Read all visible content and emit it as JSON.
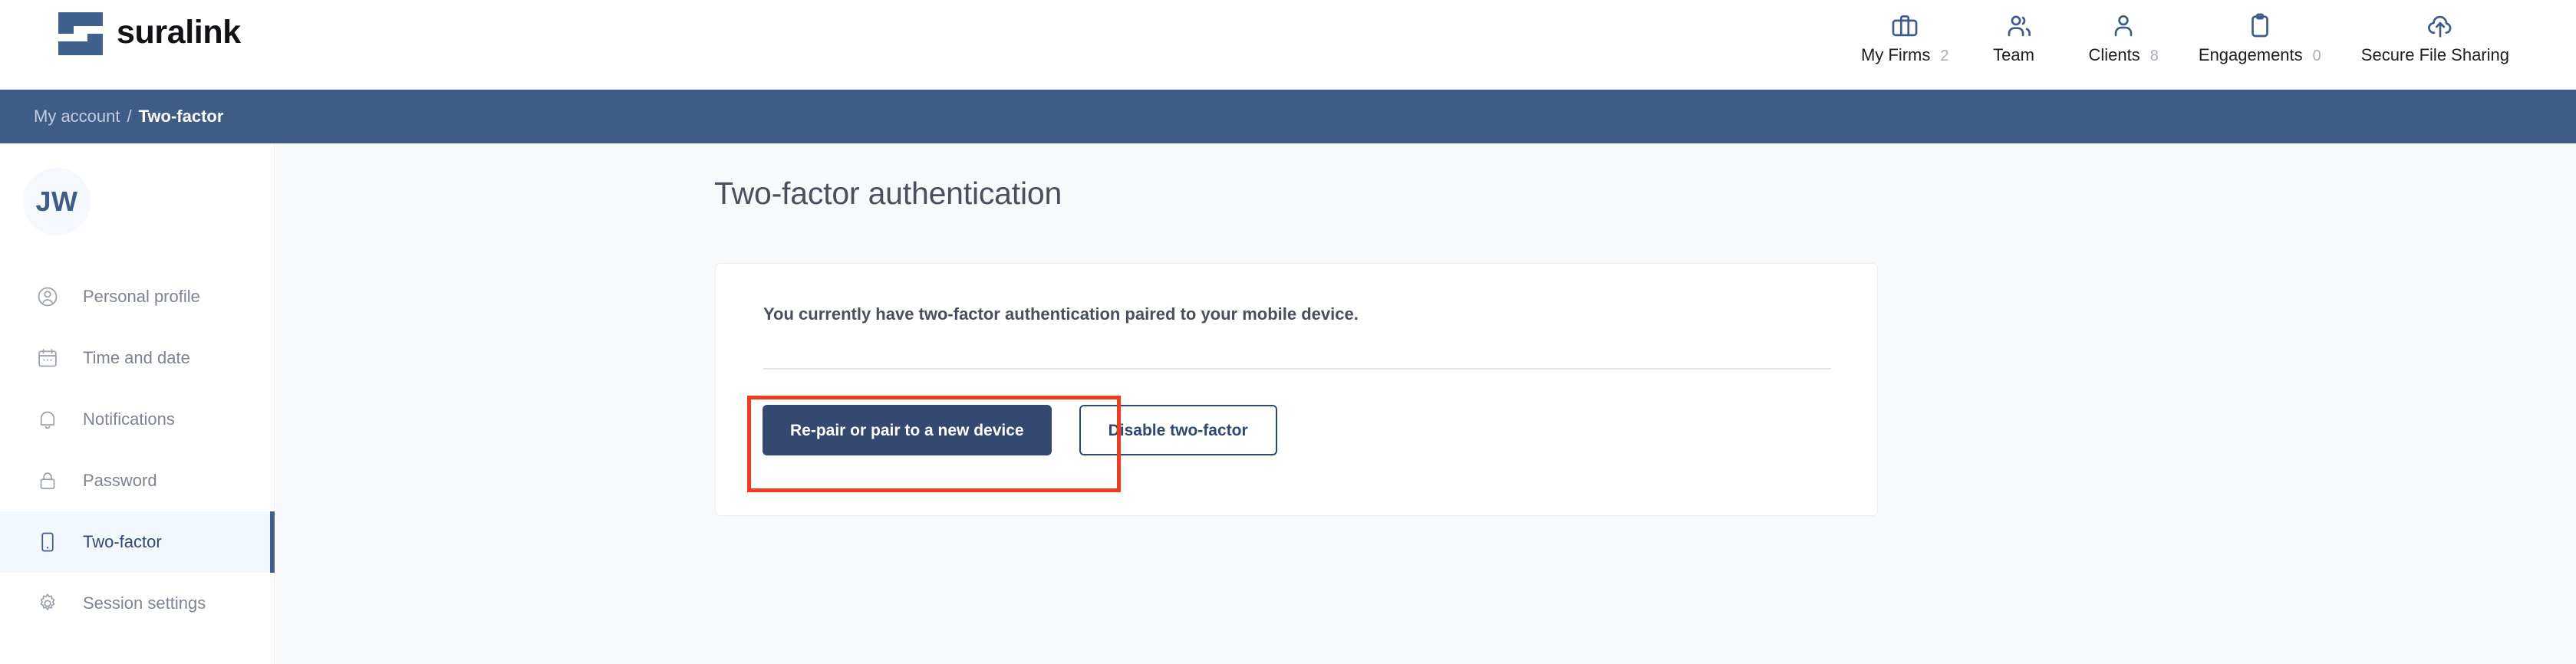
{
  "brand": {
    "name": "suralink",
    "logo_icon": "suralink-logo-icon",
    "accent_color": "#40618e"
  },
  "header": {
    "nav": [
      {
        "label": "My Firms",
        "count": "2",
        "icon": "briefcase-icon"
      },
      {
        "label": "Team",
        "count": "",
        "icon": "people-group-icon"
      },
      {
        "label": "Clients",
        "count": "8",
        "icon": "person-icon"
      },
      {
        "label": "Engagements",
        "count": "0",
        "icon": "clipboard-icon"
      },
      {
        "label": "Secure File Sharing",
        "count": "",
        "icon": "cloud-upload-icon"
      }
    ]
  },
  "breadcrumb": {
    "parent": "My account",
    "separator": "/",
    "current": "Two-factor",
    "bar_color": "#3f5c86"
  },
  "sidebar": {
    "avatar_initials": "JW",
    "items": [
      {
        "label": "Personal profile",
        "icon": "user-circle-icon",
        "active": false
      },
      {
        "label": "Time and date",
        "icon": "calendar-icon",
        "active": false
      },
      {
        "label": "Notifications",
        "icon": "bell-icon",
        "active": false
      },
      {
        "label": "Password",
        "icon": "lock-icon",
        "active": false
      },
      {
        "label": "Two-factor",
        "icon": "mobile-device-icon",
        "active": true
      },
      {
        "label": "Session settings",
        "icon": "gear-icon",
        "active": false
      }
    ]
  },
  "main": {
    "page_title": "Two-factor authentication",
    "card": {
      "status_text": "You currently have two-factor authentication paired to your mobile device.",
      "primary_button": "Re-pair or pair to a new device",
      "secondary_button": "Disable two-factor"
    }
  },
  "annotation": {
    "color": "#f03c1e",
    "target": "primary-pair-button"
  }
}
